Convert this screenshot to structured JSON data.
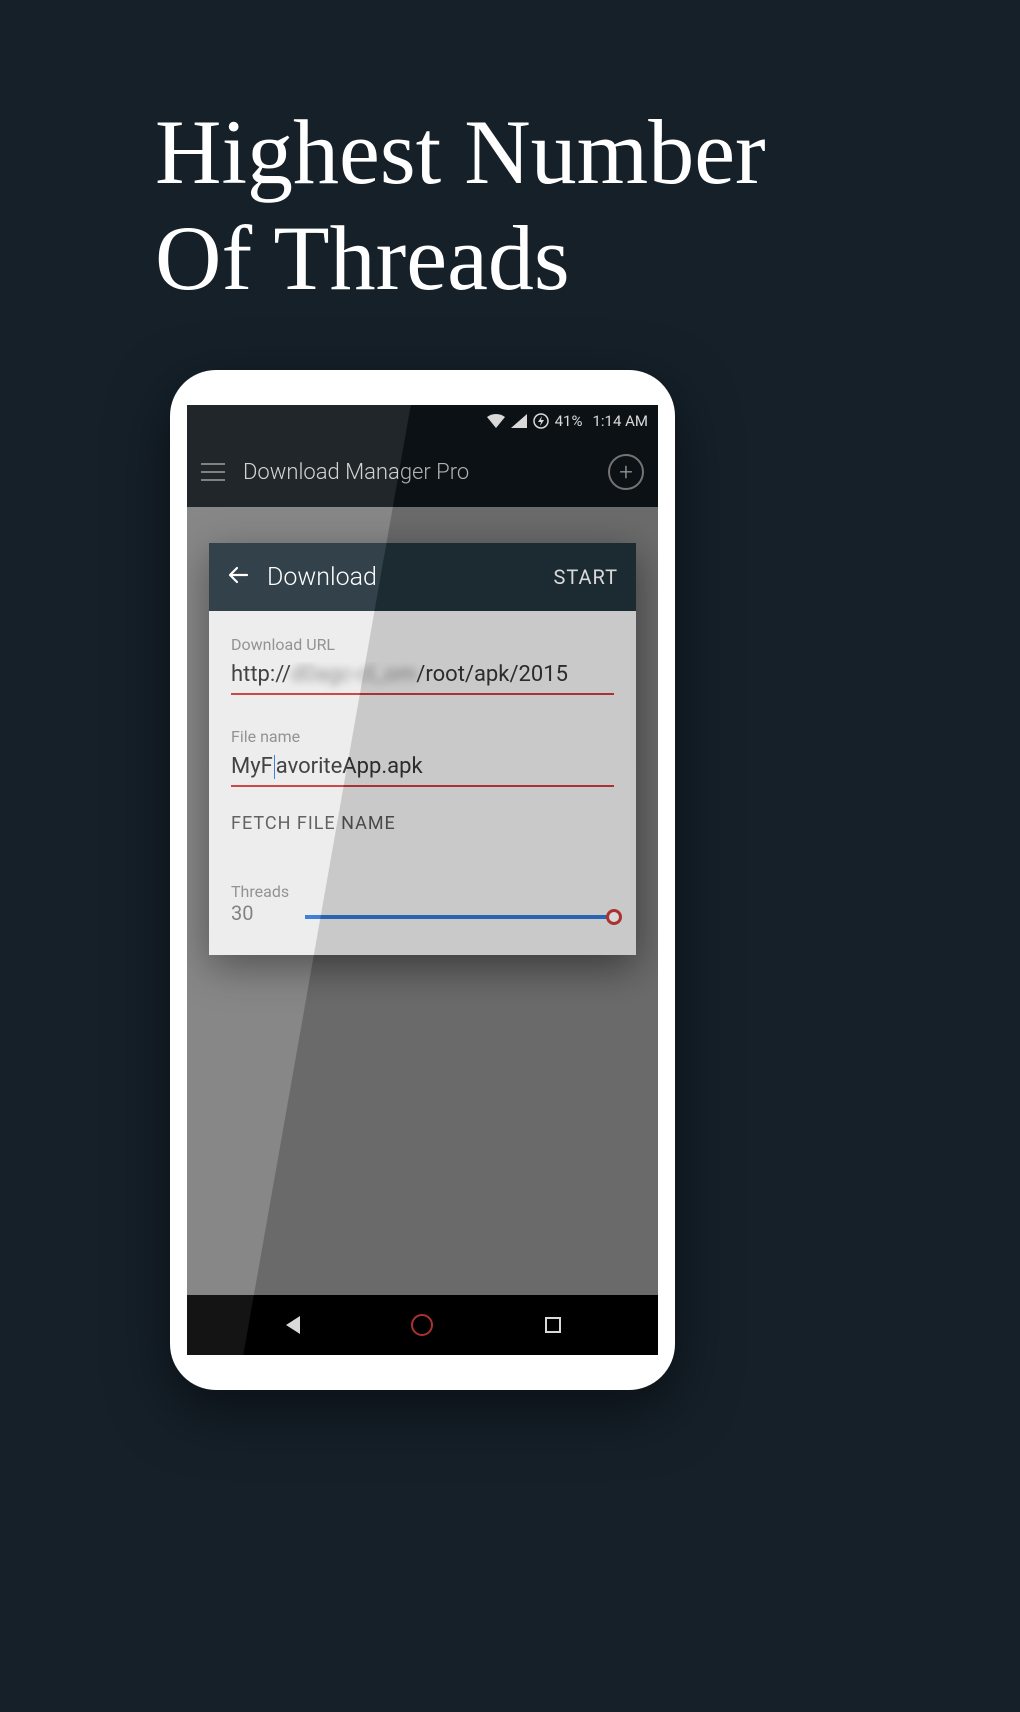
{
  "headline": {
    "line1": "Highest Number",
    "line2": "Of Threads"
  },
  "status_bar": {
    "battery_percent": "41%",
    "time": "1:14 AM"
  },
  "app_bar": {
    "title": "Download Manager Pro"
  },
  "dialog": {
    "title": "Download",
    "start_label": "START",
    "url_label": "Download URL",
    "url_prefix": "http://",
    "url_blurred": "d0agc-cl_om",
    "url_suffix": "/root/apk/2015",
    "filename_label": "File name",
    "filename_pre": "MyF",
    "filename_post": "avoriteApp.apk",
    "fetch_label": "FETCH FILE NAME",
    "threads_label": "Threads",
    "threads_value": "30"
  }
}
